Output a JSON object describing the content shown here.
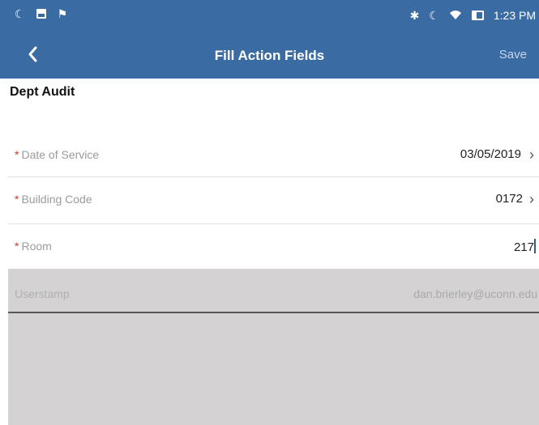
{
  "status_bar": {
    "left_icons": [
      "moon-icon",
      "image-icon",
      "flag-icon"
    ],
    "right_icons": [
      "bluetooth-icon",
      "moon-icon",
      "wifi-icon",
      "battery-icon"
    ],
    "time": "1:23 PM"
  },
  "app_bar": {
    "back_icon": "chevron-left-icon",
    "title": "Fill Action Fields",
    "save_label": "Save"
  },
  "section": {
    "title": "Dept Audit"
  },
  "fields": {
    "date_of_service": {
      "required_mark": "*",
      "label": "Date of Service",
      "value": "03/05/2019",
      "icon": "chevron-right-icon"
    },
    "building_code": {
      "required_mark": "*",
      "label": "Building Code",
      "value": "0172",
      "icon": "chevron-right-icon"
    },
    "room": {
      "required_mark": "*",
      "label": "Room",
      "value": "217"
    },
    "userstamp": {
      "label": "Userstamp",
      "value": "dan.brierley@uconn.edu"
    }
  },
  "colors": {
    "header": "#3b6ba3",
    "required": "#d0392b",
    "disabled_bg": "#d4d2d2"
  }
}
